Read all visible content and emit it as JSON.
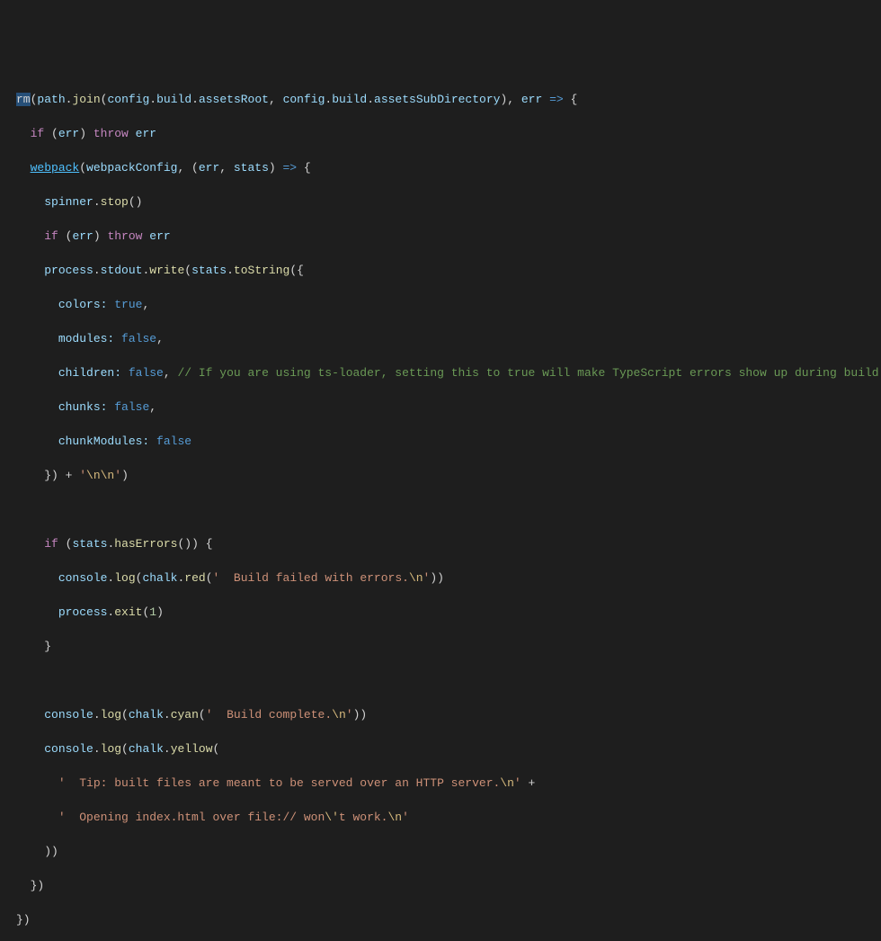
{
  "code": {
    "l1a": "rm",
    "l1b": "(",
    "l1c": "path",
    "l1d": ".",
    "l1e": "join",
    "l1f": "(",
    "l1g": "config",
    "l1h": ".",
    "l1i": "build",
    "l1j": ".",
    "l1k": "assetsRoot",
    "l1l": ", ",
    "l1m": "config",
    "l1n": ".",
    "l1o": "build",
    "l1p": ".",
    "l1q": "assetsSubDirectory",
    "l1r": "), ",
    "l1s": "err",
    "l1t": " => ",
    "l1u": "{",
    "l2a": "  ",
    "l2b": "if",
    "l2c": " (",
    "l2d": "err",
    "l2e": ") ",
    "l2f": "throw",
    "l2g": " ",
    "l2h": "err",
    "l3a": "  ",
    "l3b": "webpack",
    "l3c": "(",
    "l3d": "webpackConfig",
    "l3e": ", (",
    "l3f": "err",
    "l3g": ", ",
    "l3h": "stats",
    "l3i": ") ",
    "l3j": "=>",
    "l3k": " {",
    "l4a": "    ",
    "l4b": "spinner",
    "l4c": ".",
    "l4d": "stop",
    "l4e": "()",
    "l5a": "    ",
    "l5b": "if",
    "l5c": " (",
    "l5d": "err",
    "l5e": ") ",
    "l5f": "throw",
    "l5g": " ",
    "l5h": "err",
    "l6a": "    ",
    "l6b": "process",
    "l6c": ".",
    "l6d": "stdout",
    "l6e": ".",
    "l6f": "write",
    "l6g": "(",
    "l6h": "stats",
    "l6i": ".",
    "l6j": "toString",
    "l6k": "({",
    "l7a": "      ",
    "l7b": "colors:",
    "l7c": " ",
    "l7d": "true",
    "l7e": ",",
    "l8a": "      ",
    "l8b": "modules:",
    "l8c": " ",
    "l8d": "false",
    "l8e": ",",
    "l9a": "      ",
    "l9b": "children:",
    "l9c": " ",
    "l9d": "false",
    "l9e": ", ",
    "l9f": "// If you are using ts-loader, setting this to true will make TypeScript errors show up during build.",
    "l10a": "      ",
    "l10b": "chunks:",
    "l10c": " ",
    "l10d": "false",
    "l10e": ",",
    "l11a": "      ",
    "l11b": "chunkModules:",
    "l11c": " ",
    "l11d": "false",
    "l12a": "    }) + ",
    "l12b": "'",
    "l12c": "\\n\\n",
    "l12d": "'",
    "l12e": ")",
    "l13a": "",
    "l14a": "    ",
    "l14b": "if",
    "l14c": " (",
    "l14d": "stats",
    "l14e": ".",
    "l14f": "hasErrors",
    "l14g": "()) {",
    "l15a": "      ",
    "l15b": "console",
    "l15c": ".",
    "l15d": "log",
    "l15e": "(",
    "l15f": "chalk",
    "l15g": ".",
    "l15h": "red",
    "l15i": "(",
    "l15j": "'  Build failed with errors.",
    "l15k": "\\n",
    "l15l": "'",
    "l15m": "))",
    "l16a": "      ",
    "l16b": "process",
    "l16c": ".",
    "l16d": "exit",
    "l16e": "(",
    "l16f": "1",
    "l16g": ")",
    "l17a": "    }",
    "l18a": "",
    "l19a": "    ",
    "l19b": "console",
    "l19c": ".",
    "l19d": "log",
    "l19e": "(",
    "l19f": "chalk",
    "l19g": ".",
    "l19h": "cyan",
    "l19i": "(",
    "l19j": "'  Build complete.",
    "l19k": "\\n",
    "l19l": "'",
    "l19m": "))",
    "l20a": "    ",
    "l20b": "console",
    "l20c": ".",
    "l20d": "log",
    "l20e": "(",
    "l20f": "chalk",
    "l20g": ".",
    "l20h": "yellow",
    "l20i": "(",
    "l21a": "      ",
    "l21b": "'  Tip: built files are meant to be served over an HTTP server.",
    "l21c": "\\n",
    "l21d": "'",
    "l21e": " +",
    "l22a": "      ",
    "l22b": "'  Opening index.html over file:// won",
    "l22c": "\\'",
    "l22d": "t work.",
    "l22e": "\\n",
    "l22f": "'",
    "l23a": "    ))",
    "l24a": "  })",
    "l25a": "})"
  }
}
